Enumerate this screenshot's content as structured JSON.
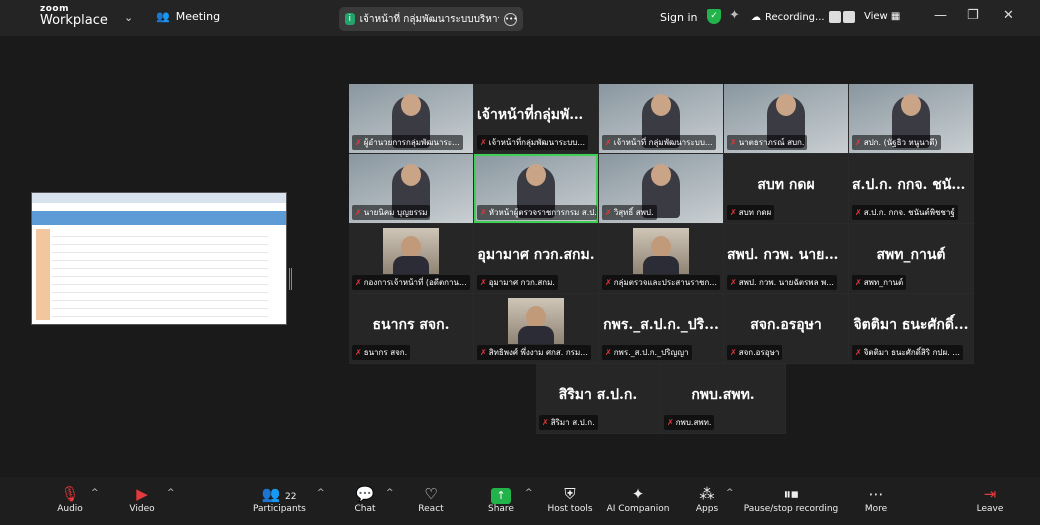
{
  "app": {
    "brand_top": "zoom",
    "brand_bottom": "Workplace",
    "meeting_label": "Meeting"
  },
  "header": {
    "meeting_title": "เจ้าหน้าที่ กลุ่มพัฒนาระบบบริหาร ส.ป.ก.",
    "sign_in": "Sign in",
    "recording": "Recording...",
    "view": "View"
  },
  "tiles": [
    {
      "big": "",
      "tag": "ผู้อำนวยการกลุ่มพัฒนาระ...",
      "video": true
    },
    {
      "big": "เจ้าหน้าที่กลุ่มพัฒ...",
      "tag": "เจ้าหน้าที่กลุ่มพัฒนาระบบ...",
      "video": false
    },
    {
      "big": "",
      "tag": "เจ้าหน้าที่ กลุ่มพัฒนาระบบ...",
      "video": true
    },
    {
      "big": "",
      "tag": "นาตธราภรณ์ สบก.",
      "video": true
    },
    {
      "big": "",
      "tag": "สปก. (นัฐธิว หนูนาดี)",
      "video": true
    },
    {
      "big": "",
      "tag": "นายนิคม บุญยรรม",
      "video": true
    },
    {
      "big": "",
      "tag": "หัวหน้าผู้ตรวจราชการกรม ส.ป....",
      "video": true
    },
    {
      "big": "",
      "tag": "วิสุทธิ์ สพป.",
      "video": true
    },
    {
      "big": "สบท กดผ",
      "tag": "สบท กดผ",
      "video": false
    },
    {
      "big": "ส.ป.ก. กกจ. ชนัน...",
      "tag": "ส.ป.ก. กกจ. ชนันต์พิชชาฐ์",
      "video": false
    },
    {
      "big": "",
      "tag": "กองการเจ้าหน้าที่ (อดีตกาน...",
      "video": false,
      "avatar": true
    },
    {
      "big": "อุมามาศ กวก.สกม.",
      "tag": "อุมามาศ กวก.สกม.",
      "video": false
    },
    {
      "big": "",
      "tag": "กลุ่มตรวจและประสานราชก...",
      "video": false,
      "avatar": true
    },
    {
      "big": "สพป. กวพ. นายฉั...",
      "tag": "สพป. กวพ. นายฉัตรพล พ...",
      "video": false
    },
    {
      "big": "สพท_กานต์",
      "tag": "สพท_กานต์",
      "video": false
    },
    {
      "big": "ธนากร สจก.",
      "tag": "ธนากร สจก.",
      "video": false
    },
    {
      "big": "",
      "tag": "สิทธิพงศ์ พึ่งงาม ศกส. กรม...",
      "video": false,
      "avatar": true
    },
    {
      "big": "กพร._ส.ป.ก._ปริ...",
      "tag": "กพร._ส.ป.ก._ปริญญา",
      "video": false
    },
    {
      "big": "สจก.อรอุษา",
      "tag": "สจก.อรอุษา",
      "video": false
    },
    {
      "big": "จิตติมา ธนะศักดิ์...",
      "tag": "จิตติมา ธนะศักดิ์สิริ กปผ. ...",
      "video": false
    }
  ],
  "tiles_row2": [
    {
      "big": "สิริมา ส.ป.ก.",
      "tag": "สิริมา ส.ป.ก."
    },
    {
      "big": "กพบ.สพท.",
      "tag": "กพบ.สพท."
    }
  ],
  "toolbar": {
    "audio": "Audio",
    "video": "Video",
    "participants": "Participants",
    "participants_count": "22",
    "chat": "Chat",
    "react": "React",
    "share": "Share",
    "host_tools": "Host tools",
    "ai_companion": "AI Companion",
    "apps": "Apps",
    "recording": "Pause/stop recording",
    "more": "More",
    "leave": "Leave"
  }
}
